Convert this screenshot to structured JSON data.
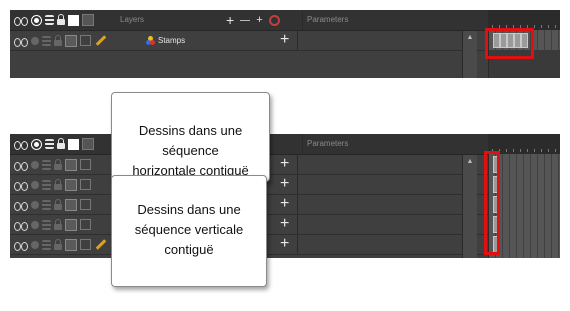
{
  "top_panel": {
    "header": {
      "layers_label": "Layers",
      "parameters_label": "Parameters"
    },
    "layer_row": {
      "name": "Stamps",
      "icons": [
        "eyes-icon",
        "dot-icon",
        "stack-icon",
        "lock-icon",
        "color-swatch-icon",
        "box-icon",
        "pencil-icon"
      ]
    },
    "timeline_cells": 5
  },
  "bottom_panel": {
    "header": {
      "parameters_label": "Parameters"
    },
    "layer_rows": 5,
    "timeline_cells_per_row": 1
  },
  "callouts": {
    "horizontal": {
      "line1": "Dessins dans une",
      "line2": "séquence",
      "line3": "horizontale contiguë"
    },
    "vertical": {
      "line1": "Dessins dans une",
      "line2": "séquence verticale",
      "line3": "contiguë"
    }
  },
  "colors": {
    "highlight": "#e01010",
    "panel_bg": "#3f3f3f",
    "header_bg": "#323232"
  }
}
